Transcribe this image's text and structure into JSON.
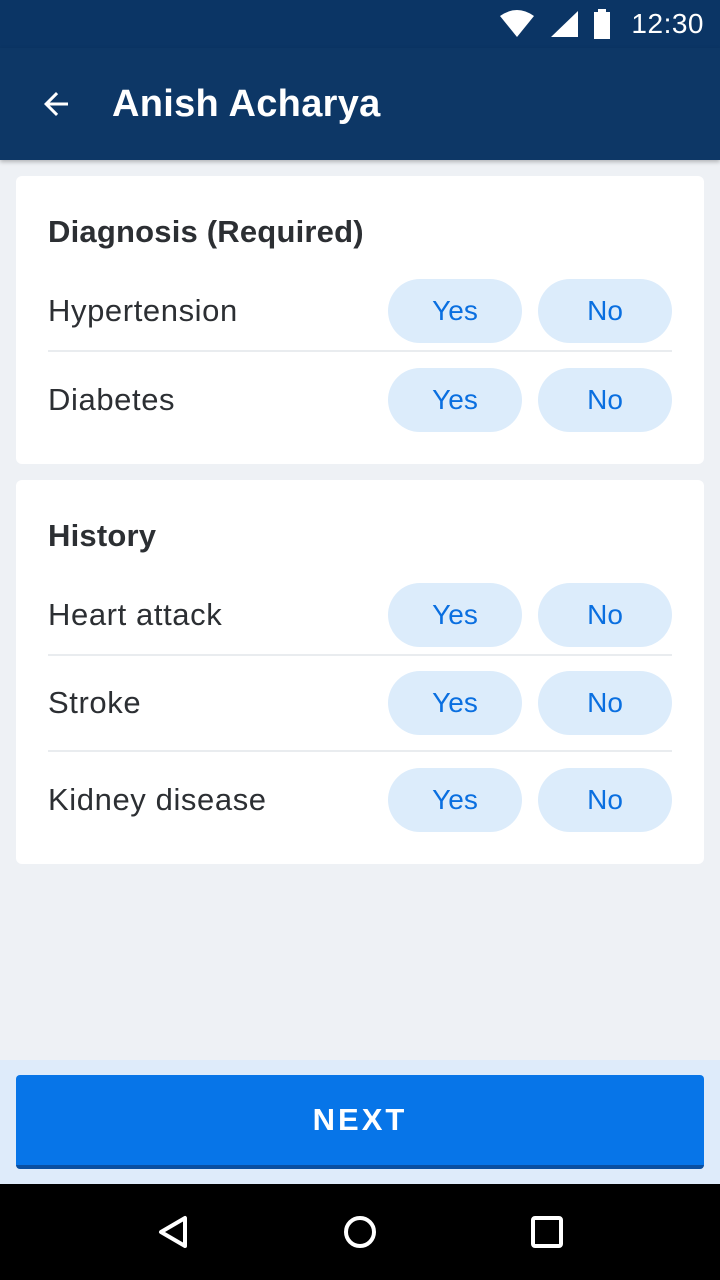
{
  "status_bar": {
    "time": "12:30",
    "icons": [
      "wifi-icon",
      "cellular-signal-icon",
      "battery-icon"
    ]
  },
  "app_bar": {
    "title": "Anish Acharya",
    "back_icon": "arrow-back-icon"
  },
  "diagnosis": {
    "title": "Diagnosis (Required)",
    "items": [
      {
        "label": "Hypertension",
        "yes": "Yes",
        "no": "No"
      },
      {
        "label": "Diabetes",
        "yes": "Yes",
        "no": "No"
      }
    ]
  },
  "history": {
    "title": "History",
    "items": [
      {
        "label": "Heart attack",
        "yes": "Yes",
        "no": "No"
      },
      {
        "label": "Stroke",
        "yes": "Yes",
        "no": "No"
      },
      {
        "label": "Kidney disease",
        "yes": "Yes",
        "no": "No"
      }
    ]
  },
  "footer": {
    "next_label": "NEXT"
  },
  "nav_bar": {
    "icons": [
      "back-triangle-icon",
      "home-circle-icon",
      "recents-square-icon"
    ]
  },
  "colors": {
    "primary_dark": "#0d3766",
    "accent": "#0775e8",
    "pill_bg": "#dcecfb",
    "pill_text": "#0a6fe0"
  }
}
